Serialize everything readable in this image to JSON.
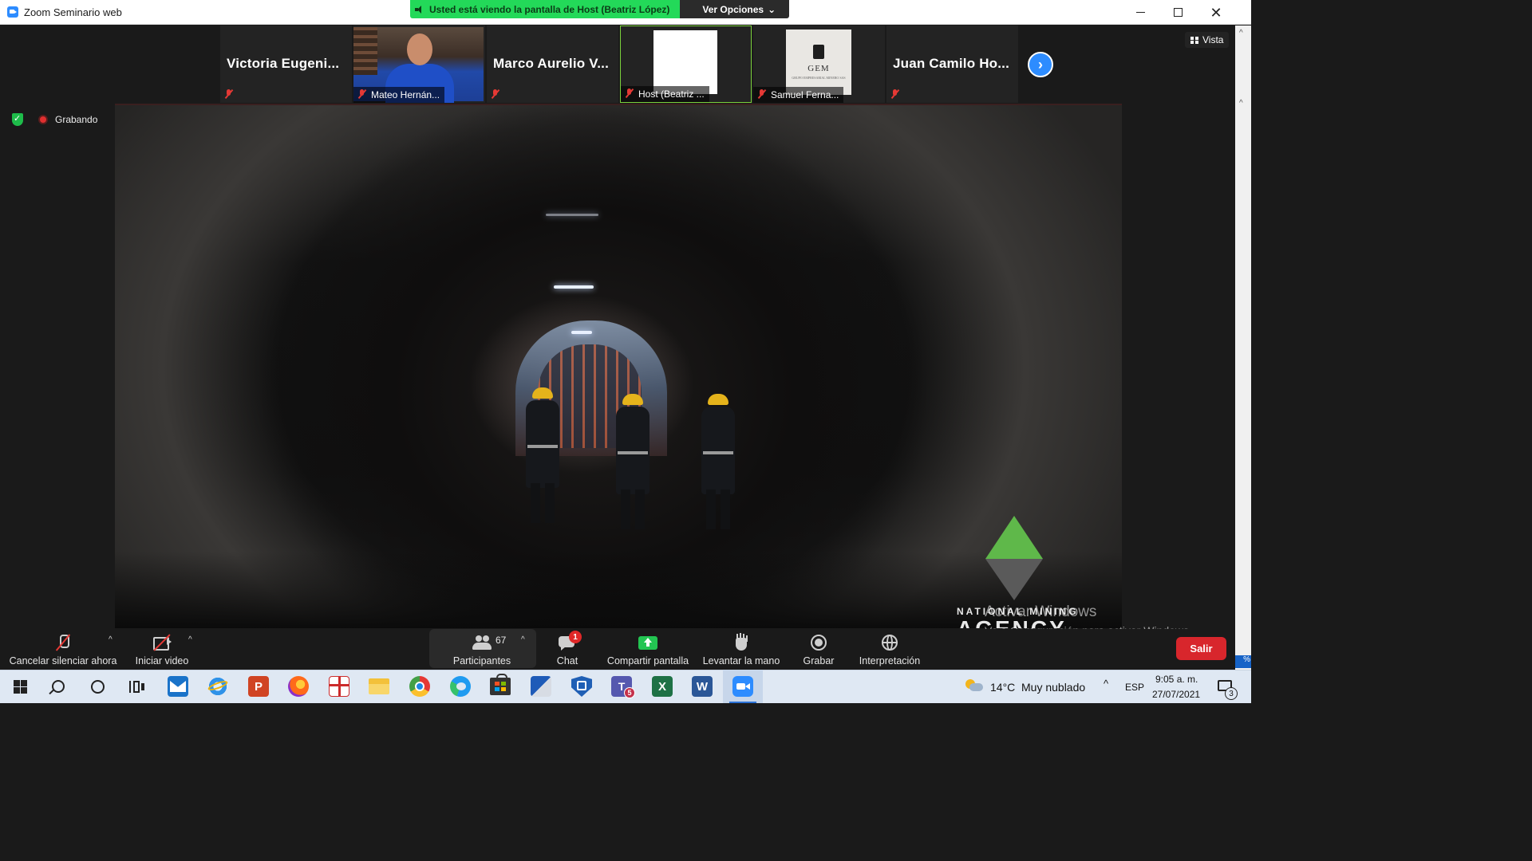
{
  "window": {
    "title": "Zoom Seminario web"
  },
  "share_banner": {
    "message": "Usted está viendo la pantalla de Host (Beatriz López)",
    "options_label": "Ver Opciones"
  },
  "view_button": {
    "label": "Vista"
  },
  "recording": {
    "label": "Grabando"
  },
  "participants_strip": [
    {
      "name": "Victoria Eugeni...",
      "has_video": false
    },
    {
      "name": "Mateo Hernán...",
      "has_video": true
    },
    {
      "name": "Marco Aurelio V...",
      "has_video": false
    },
    {
      "name": "Host (Beatriz ...",
      "has_video": true,
      "active": true
    },
    {
      "name": "Samuel Ferna...",
      "has_video": true
    },
    {
      "name": "Juan Camilo Ho...",
      "has_video": false
    }
  ],
  "tile_logo": {
    "text": "GEM",
    "subtext": "GRUPO EMPRESARIAL MINERO SAS"
  },
  "shared_content": {
    "watermark_line1": "NATIONAL MINING",
    "watermark_line2": "AGENCY"
  },
  "activation": {
    "line1": "Activar Windows",
    "line2": "Ve a Configuración para activar Windows."
  },
  "toolbar": {
    "unmute": "Cancelar silenciar ahora",
    "start_video": "Iniciar video",
    "participants": "Participantes",
    "participants_count": "67",
    "chat": "Chat",
    "chat_badge": "1",
    "share": "Compartir pantalla",
    "raise_hand": "Levantar la mano",
    "record": "Grabar",
    "interpretation": "Interpretación",
    "leave": "Salir",
    "edge_pct": "%"
  },
  "taskbar": {
    "teams_badge": "5",
    "weather_temp": "14°C",
    "weather_desc": "Muy nublado",
    "language": "ESP",
    "time": "9:05 a. m.",
    "date": "27/07/2021",
    "notifications_count": "3"
  },
  "colors": {
    "share_banner_green": "#23d959",
    "leave_red": "#d8262c",
    "zoom_blue": "#2d8cff",
    "share_icon_green": "#23c552"
  }
}
